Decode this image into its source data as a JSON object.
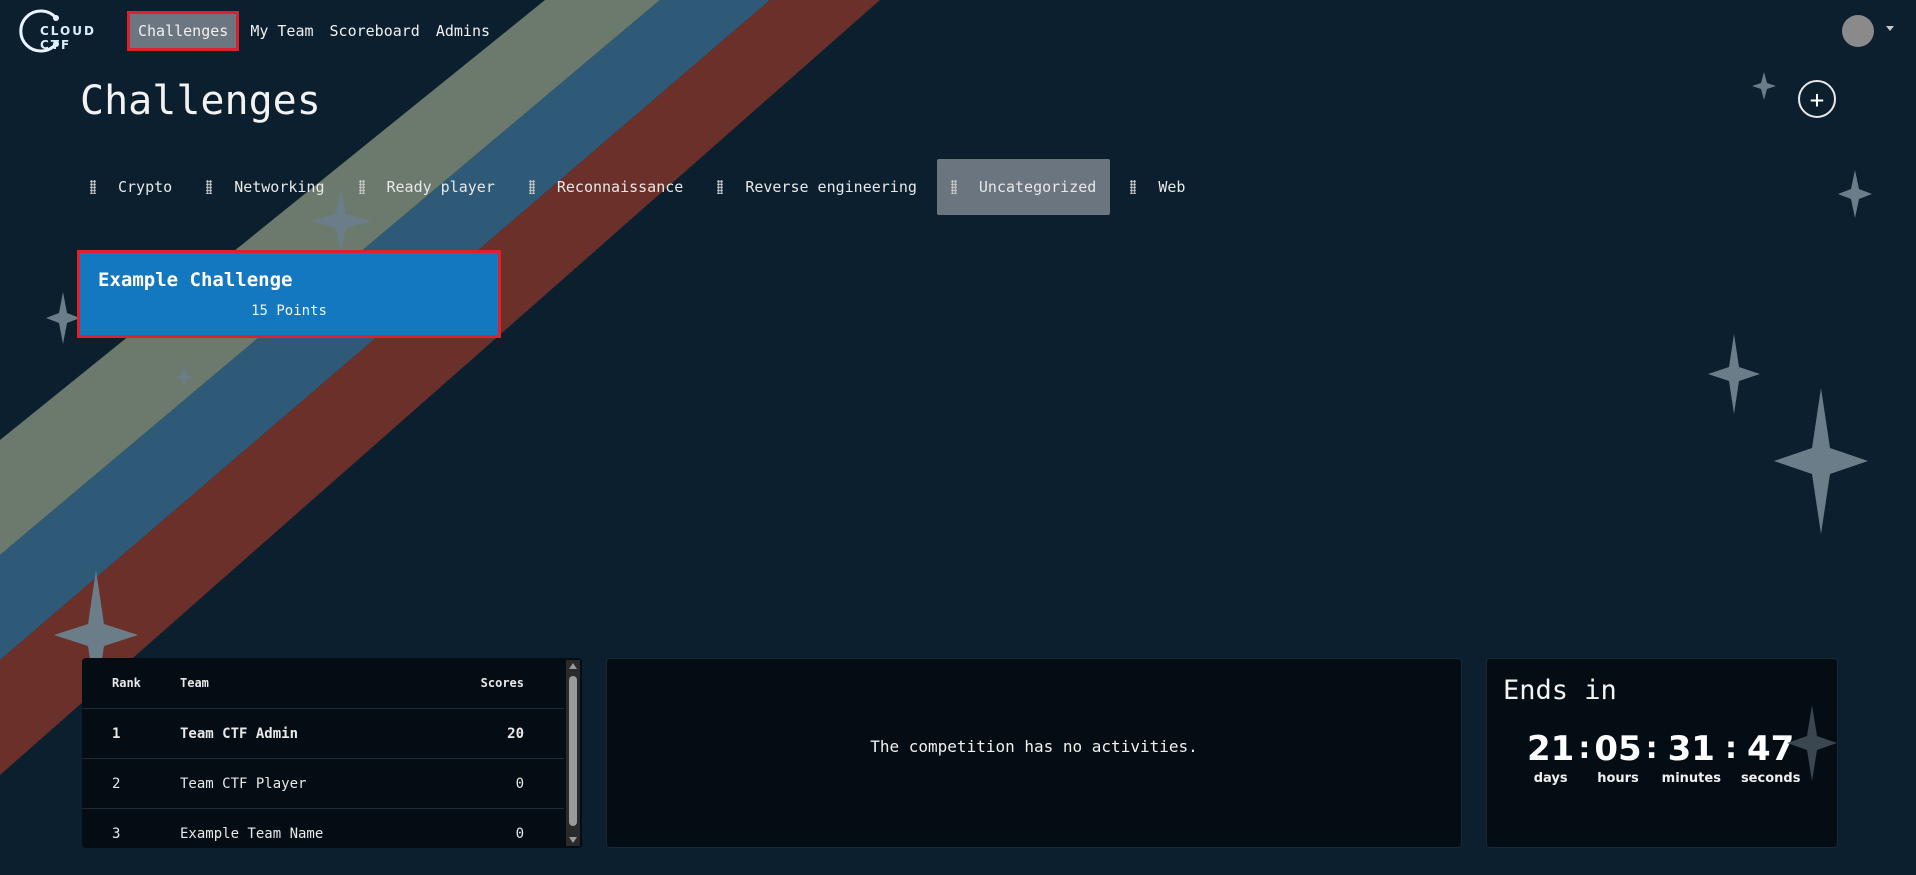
{
  "brand": {
    "logo_text": "CLOUD CTF",
    "accent": "#1378bf",
    "highlight": "#e0202a"
  },
  "nav": {
    "links": [
      {
        "label": "Challenges",
        "active": true
      },
      {
        "label": "My Team",
        "active": false
      },
      {
        "label": "Scoreboard",
        "active": false
      },
      {
        "label": "Admins",
        "active": false
      }
    ],
    "avatar_icon": "user-avatar",
    "menu_icon": "caret-down-icon"
  },
  "page": {
    "title": "Challenges",
    "add_label": "+"
  },
  "categories": [
    {
      "label": "Crypto",
      "active": false
    },
    {
      "label": "Networking",
      "active": false
    },
    {
      "label": "Ready player",
      "active": false
    },
    {
      "label": "Reconnaissance",
      "active": false
    },
    {
      "label": "Reverse engineering",
      "active": false
    },
    {
      "label": "Uncategorized",
      "active": true
    },
    {
      "label": "Web",
      "active": false
    }
  ],
  "challenge": {
    "name": "Example Challenge",
    "points": "15 Points"
  },
  "scoreboard": {
    "headers": {
      "rank": "Rank",
      "team": "Team",
      "score": "Scores"
    },
    "rows": [
      {
        "rank": "1",
        "team": "Team CTF Admin",
        "score": "20"
      },
      {
        "rank": "2",
        "team": "Team CTF Player",
        "score": "0"
      },
      {
        "rank": "3",
        "team": "Example Team Name",
        "score": "0"
      }
    ]
  },
  "activity": {
    "empty_text": "The competition has no activities."
  },
  "timer": {
    "title": "Ends in",
    "days": "21",
    "hours": "05",
    "minutes": "31",
    "seconds": "47",
    "labels": {
      "days": "days",
      "hours": "hours",
      "minutes": "minutes",
      "seconds": "seconds"
    },
    "sep": ":"
  },
  "decor": {
    "stripe_colors": [
      "#6b7a6c",
      "#2e5a78",
      "#6a3029"
    ],
    "sparkle_color": "#7a8a96"
  }
}
